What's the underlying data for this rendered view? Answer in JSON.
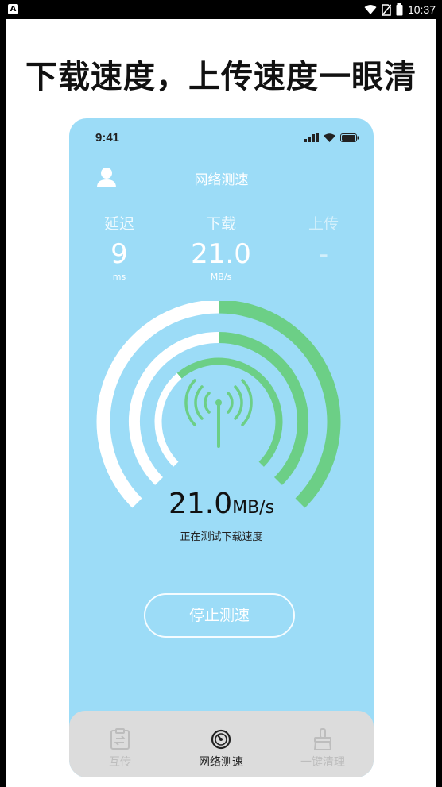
{
  "status_bar": {
    "notification_icon": "A",
    "time": "10:37",
    "icons": [
      "wifi-icon",
      "no-sim-icon",
      "battery-icon"
    ]
  },
  "headline": "下载速度，上传速度一眼清",
  "phone": {
    "status_time": "9:41",
    "title": "网络测速",
    "metrics": [
      {
        "label": "延迟",
        "value": "9",
        "unit": "ms"
      },
      {
        "label": "下载",
        "value": "21.0",
        "unit": "MB/s"
      },
      {
        "label": "上传",
        "value": "-",
        "unit": ""
      }
    ],
    "gauge": {
      "outer_progress": 0.5,
      "middle_progress": 0.5,
      "inner_progress": 0.35,
      "green": "#6ccf86",
      "white": "#ffffff"
    },
    "speed_value": "21.0",
    "speed_unit": "MB/s",
    "speed_status": "正在测试下载速度",
    "stop_button": "停止测速",
    "tabs": [
      {
        "label": "互传",
        "icon": "clipboard-icon",
        "active": false
      },
      {
        "label": "网络测速",
        "icon": "speedometer-icon",
        "active": true
      },
      {
        "label": "一键清理",
        "icon": "broom-icon",
        "active": false
      }
    ]
  },
  "colors": {
    "phone_bg": "#9cdcf7",
    "accent_green": "#6ccf86",
    "tabbar_bg": "#dcdcdc"
  }
}
